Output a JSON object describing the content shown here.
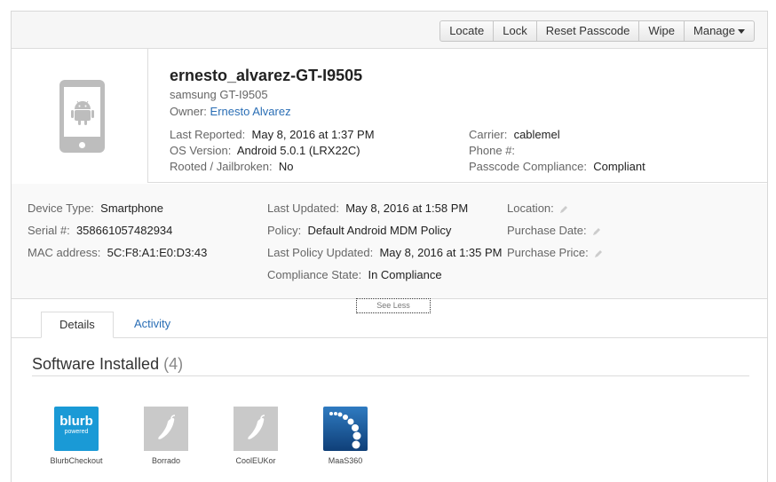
{
  "toolbar": {
    "buttons": [
      "Locate",
      "Lock",
      "Reset Passcode",
      "Wipe",
      "Manage"
    ]
  },
  "device": {
    "name": "ernesto_alvarez-GT-I9505",
    "model": "samsung GT-I9505",
    "owner_label": "Owner:",
    "owner_value": "Ernesto Alvarez",
    "platform_icon": "android-phone-icon"
  },
  "summary": {
    "last_reported_label": "Last Reported:",
    "last_reported_value": "May 8, 2016 at 1:37 PM",
    "os_label": "OS Version:",
    "os_value": "Android 5.0.1 (LRX22C)",
    "rooted_label": "Rooted / Jailbroken:",
    "rooted_value": "No",
    "carrier_label": "Carrier:",
    "carrier_value": "cablemel",
    "phone_label": "Phone #:",
    "phone_value": "",
    "passcode_label": "Passcode Compliance:",
    "passcode_value": "Compliant"
  },
  "details": {
    "device_type_label": "Device Type:",
    "device_type_value": "Smartphone",
    "serial_label": "Serial #:",
    "serial_value": "358661057482934",
    "mac_label": "MAC address:",
    "mac_value": "5C:F8:A1:E0:D3:43",
    "last_updated_label": "Last Updated:",
    "last_updated_value": "May 8, 2016 at 1:58 PM",
    "policy_label": "Policy:",
    "policy_value": "Default Android MDM Policy",
    "last_policy_label": "Last Policy Updated:",
    "last_policy_value": "May 8, 2016 at 1:35 PM",
    "compliance_label": "Compliance State:",
    "compliance_value": "In Compliance",
    "location_label": "Location:",
    "purchase_date_label": "Purchase Date:",
    "purchase_price_label": "Purchase Price:",
    "see_less": "See Less"
  },
  "tabs": [
    "Details",
    "Activity"
  ],
  "software": {
    "title": "Software Installed",
    "count": "(4)",
    "apps": [
      {
        "name": "BlurbCheckout",
        "icon": "blurb-icon",
        "logo_text": "blurb",
        "logo_sub": "powered"
      },
      {
        "name": "Borrado",
        "icon": "pepper-icon"
      },
      {
        "name": "CoolEUKor",
        "icon": "pepper-icon"
      },
      {
        "name": "MaaS360",
        "icon": "maas360-icon"
      }
    ]
  },
  "colors": {
    "link": "#2a6eb5",
    "blurb": "#1a9ad6",
    "maas": "#1f5fa3"
  }
}
